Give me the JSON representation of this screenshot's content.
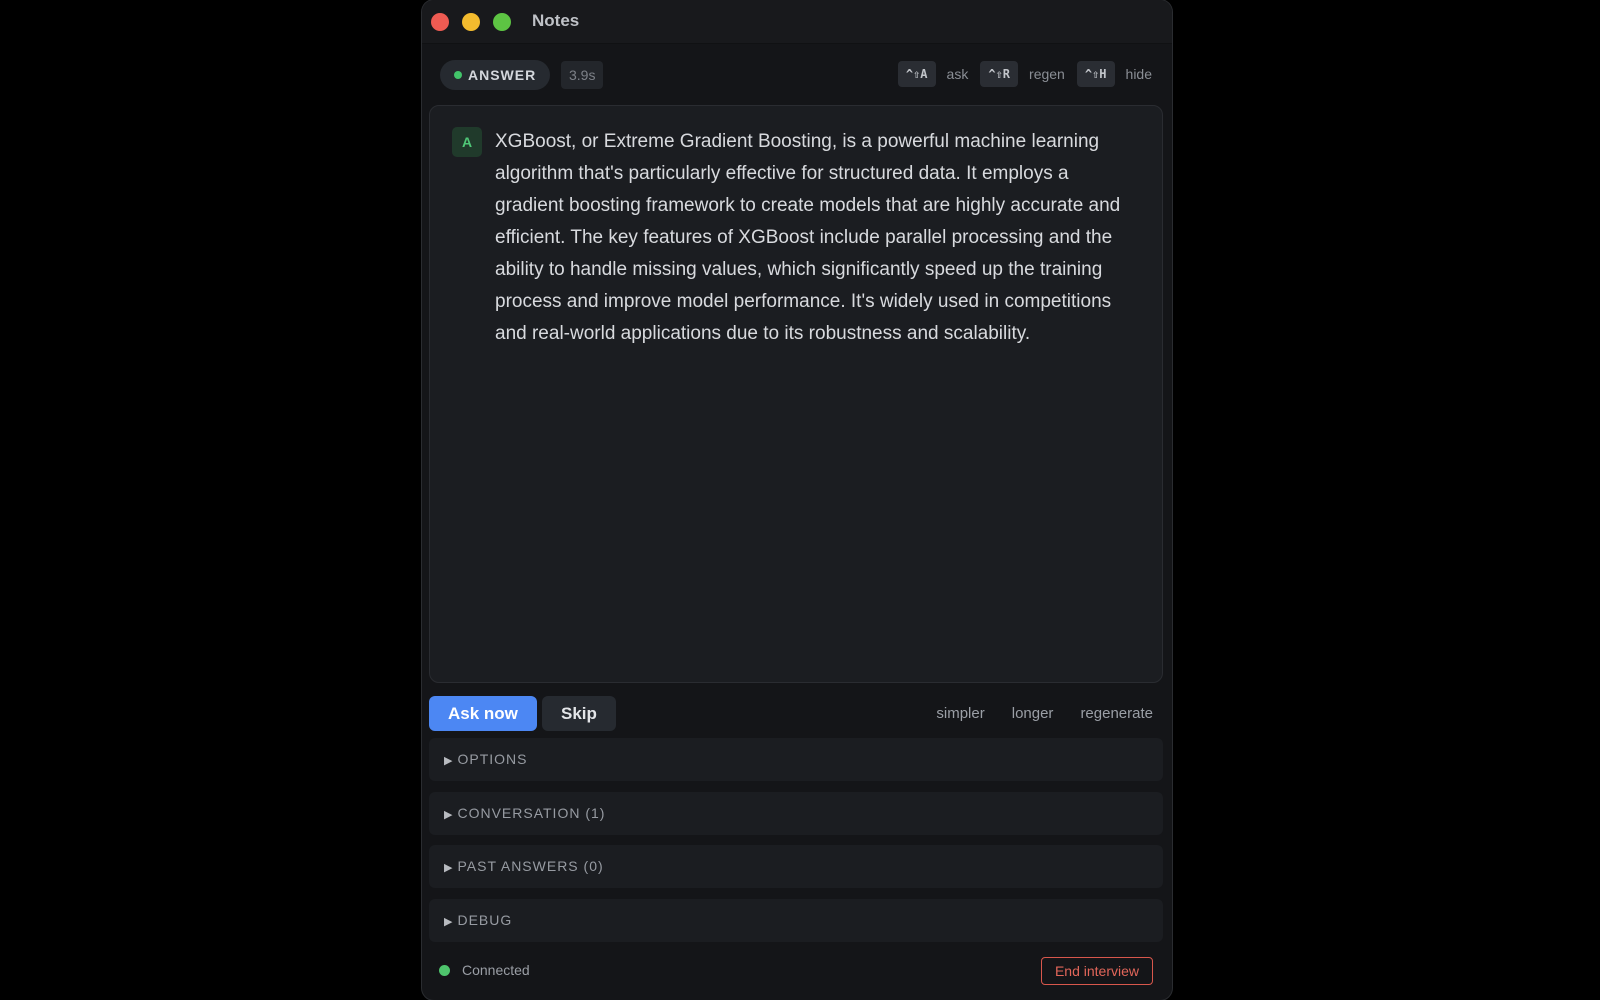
{
  "window": {
    "title": "Notes",
    "controls": [
      "close",
      "minimize",
      "maximize"
    ]
  },
  "toolbar": {
    "mode_label": "ANSWER",
    "timer": "3.9s",
    "shortcuts": [
      {
        "keys": "^⇧A",
        "label": "ask"
      },
      {
        "keys": "^⇧R",
        "label": "regen"
      },
      {
        "keys": "^⇧H",
        "label": "hide"
      }
    ]
  },
  "answer": {
    "avatar": "A",
    "text": "XGBoost, or Extreme Gradient Boosting, is a powerful machine learning algorithm that's particularly effective for structured data. It employs a gradient boosting framework to create models that are highly accurate and efficient. The key features of XGBoost include parallel processing and the ability to handle missing values, which significantly speed up the training process and improve model performance. It's widely used in competitions and real-world applications due to its robustness and scalability."
  },
  "actions": {
    "ask_now": "Ask now",
    "skip": "Skip",
    "tweaks": [
      "simpler",
      "longer",
      "regenerate"
    ]
  },
  "sections": [
    {
      "label": "OPTIONS"
    },
    {
      "label": "CONVERSATION (1)"
    },
    {
      "label": "PAST ANSWERS (0)"
    },
    {
      "label": "DEBUG"
    }
  ],
  "footer": {
    "status": "Connected",
    "end_button": "End interview"
  },
  "colors": {
    "accent": "#4c87f3",
    "status_green": "#42c46a",
    "danger": "#d8574c",
    "background": "#141518"
  }
}
